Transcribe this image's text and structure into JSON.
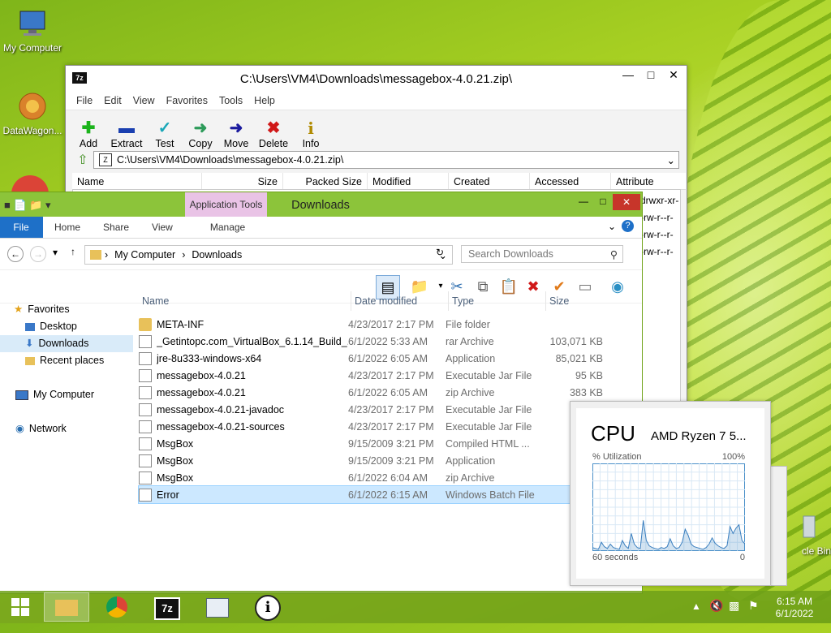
{
  "desktop": {
    "icons": [
      {
        "label": "My Computer"
      },
      {
        "label": "DataWagon..."
      },
      {
        "label": "cle Bin"
      }
    ]
  },
  "sevenzip": {
    "title": "C:\\Users\\VM4\\Downloads\\messagebox-4.0.21.zip\\",
    "menu": [
      "File",
      "Edit",
      "View",
      "Favorites",
      "Tools",
      "Help"
    ],
    "toolbar": [
      "Add",
      "Extract",
      "Test",
      "Copy",
      "Move",
      "Delete",
      "Info"
    ],
    "address": "C:\\Users\\VM4\\Downloads\\messagebox-4.0.21.zip\\",
    "columns": [
      "Name",
      "Size",
      "Packed Size",
      "Modified",
      "Created",
      "Accessed",
      "Attribute"
    ],
    "attributes": [
      "drwxr-xr-",
      "-rw-r--r-",
      "-rw-r--r-",
      "-rw-r--r-"
    ]
  },
  "explorer": {
    "title": "Downloads",
    "app_tools": "Application Tools",
    "ribbon_tabs": [
      "File",
      "Home",
      "Share",
      "View",
      "Manage"
    ],
    "breadcrumb": [
      "My Computer",
      "Downloads"
    ],
    "search_placeholder": "Search Downloads",
    "nav": {
      "favorites": "Favorites",
      "items": [
        "Desktop",
        "Downloads",
        "Recent places"
      ],
      "my_computer": "My Computer",
      "network": "Network"
    },
    "columns": [
      "Name",
      "Date modified",
      "Type",
      "Size"
    ],
    "files": [
      {
        "name": "META-INF",
        "date": "4/23/2017 2:17 PM",
        "type": "File folder",
        "size": ""
      },
      {
        "name": "_Getintopc.com_VirtualBox_6.1.14_Build_...",
        "date": "6/1/2022 5:33 AM",
        "type": "rar Archive",
        "size": "103,071 KB"
      },
      {
        "name": "jre-8u333-windows-x64",
        "date": "6/1/2022 6:05 AM",
        "type": "Application",
        "size": "85,021 KB"
      },
      {
        "name": "messagebox-4.0.21",
        "date": "4/23/2017 2:17 PM",
        "type": "Executable Jar File",
        "size": "95 KB"
      },
      {
        "name": "messagebox-4.0.21",
        "date": "6/1/2022 6:05 AM",
        "type": "zip Archive",
        "size": "383 KB"
      },
      {
        "name": "messagebox-4.0.21-javadoc",
        "date": "4/23/2017 2:17 PM",
        "type": "Executable Jar File",
        "size": ""
      },
      {
        "name": "messagebox-4.0.21-sources",
        "date": "4/23/2017 2:17 PM",
        "type": "Executable Jar File",
        "size": ""
      },
      {
        "name": "MsgBox",
        "date": "9/15/2009 3:21 PM",
        "type": "Compiled HTML ...",
        "size": ""
      },
      {
        "name": "MsgBox",
        "date": "9/15/2009 3:21 PM",
        "type": "Application",
        "size": ""
      },
      {
        "name": "MsgBox",
        "date": "6/1/2022 6:04 AM",
        "type": "zip Archive",
        "size": ""
      },
      {
        "name": "Error",
        "date": "6/1/2022 6:15 AM",
        "type": "Windows Batch File",
        "size": ""
      }
    ]
  },
  "cpu": {
    "title": "CPU",
    "model": "AMD Ryzen 7 5...",
    "util_label": "% Utilization",
    "max_label": "100%",
    "time_label": "60 seconds",
    "min_label": "0",
    "samples": [
      4,
      3,
      2,
      10,
      5,
      3,
      8,
      4,
      3,
      2,
      12,
      6,
      3,
      20,
      8,
      4,
      3,
      35,
      12,
      6,
      4,
      3,
      2,
      4,
      3,
      5,
      14,
      6,
      3,
      4,
      10,
      25,
      18,
      8,
      5,
      4,
      3,
      2,
      4,
      8,
      15,
      9,
      6,
      4,
      3,
      6,
      28,
      20,
      26,
      30,
      12,
      8
    ]
  },
  "taskbar": {
    "time": "6:15 AM",
    "date": "6/1/2022"
  }
}
